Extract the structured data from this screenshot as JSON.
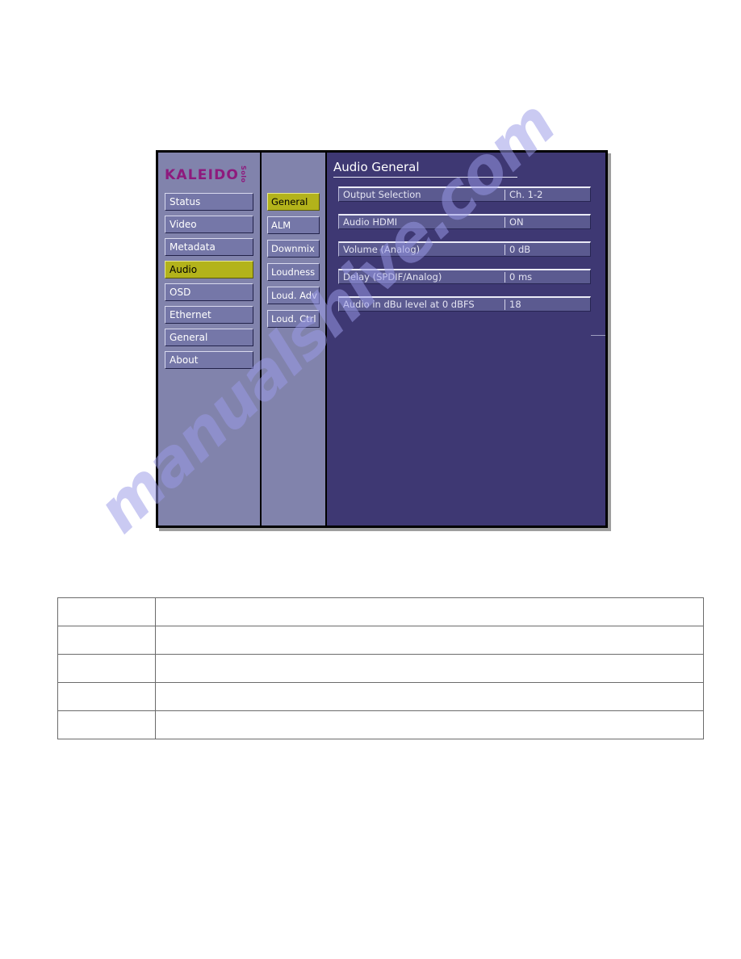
{
  "device_ui": {
    "logo": {
      "brand": "KALEIDO",
      "model": "Solo"
    },
    "main_menu": {
      "items": [
        {
          "label": "Status",
          "selected": false
        },
        {
          "label": "Video",
          "selected": false
        },
        {
          "label": "Metadata",
          "selected": false
        },
        {
          "label": "Audio",
          "selected": true
        },
        {
          "label": "OSD",
          "selected": false
        },
        {
          "label": "Ethernet",
          "selected": false
        },
        {
          "label": "General",
          "selected": false
        },
        {
          "label": "About",
          "selected": false
        }
      ]
    },
    "sub_menu": {
      "items": [
        {
          "label": "General",
          "selected": true
        },
        {
          "label": "ALM",
          "selected": false
        },
        {
          "label": "Downmix",
          "selected": false
        },
        {
          "label": "Loudness",
          "selected": false
        },
        {
          "label": "Loud. Adv",
          "selected": false
        },
        {
          "label": "Loud. Ctrl",
          "selected": false
        }
      ]
    },
    "panel": {
      "title": "Audio General",
      "rows": [
        {
          "label": "Output Selection",
          "value": "Ch. 1-2"
        },
        {
          "label": "Audio HDMI",
          "value": "ON"
        },
        {
          "label": "Volume (Analog)",
          "value": "0 dB"
        },
        {
          "label": "Delay (SPDIF/Analog)",
          "value": "0 ms"
        },
        {
          "label": "Audio in dBu level at 0 dBFS",
          "value": "18"
        }
      ]
    },
    "colors": {
      "menu_panel_bg": "#8183ac",
      "content_panel_bg": "#3e3873",
      "button_bg": "#7577a8",
      "selected_button_bg": "#b3b31b",
      "row_bg": "#5b5a90",
      "logo_magenta": "#8e1a7d",
      "text_white": "#ffffff"
    }
  },
  "info_table": {
    "rows": [
      {
        "col_a": "",
        "col_b": ""
      },
      {
        "col_a": "",
        "col_b": ""
      },
      {
        "col_a": "",
        "col_b": ""
      },
      {
        "col_a": "",
        "col_b": ""
      },
      {
        "col_a": "",
        "col_b": ""
      }
    ]
  },
  "watermark": {
    "text": "manualshive.com"
  }
}
